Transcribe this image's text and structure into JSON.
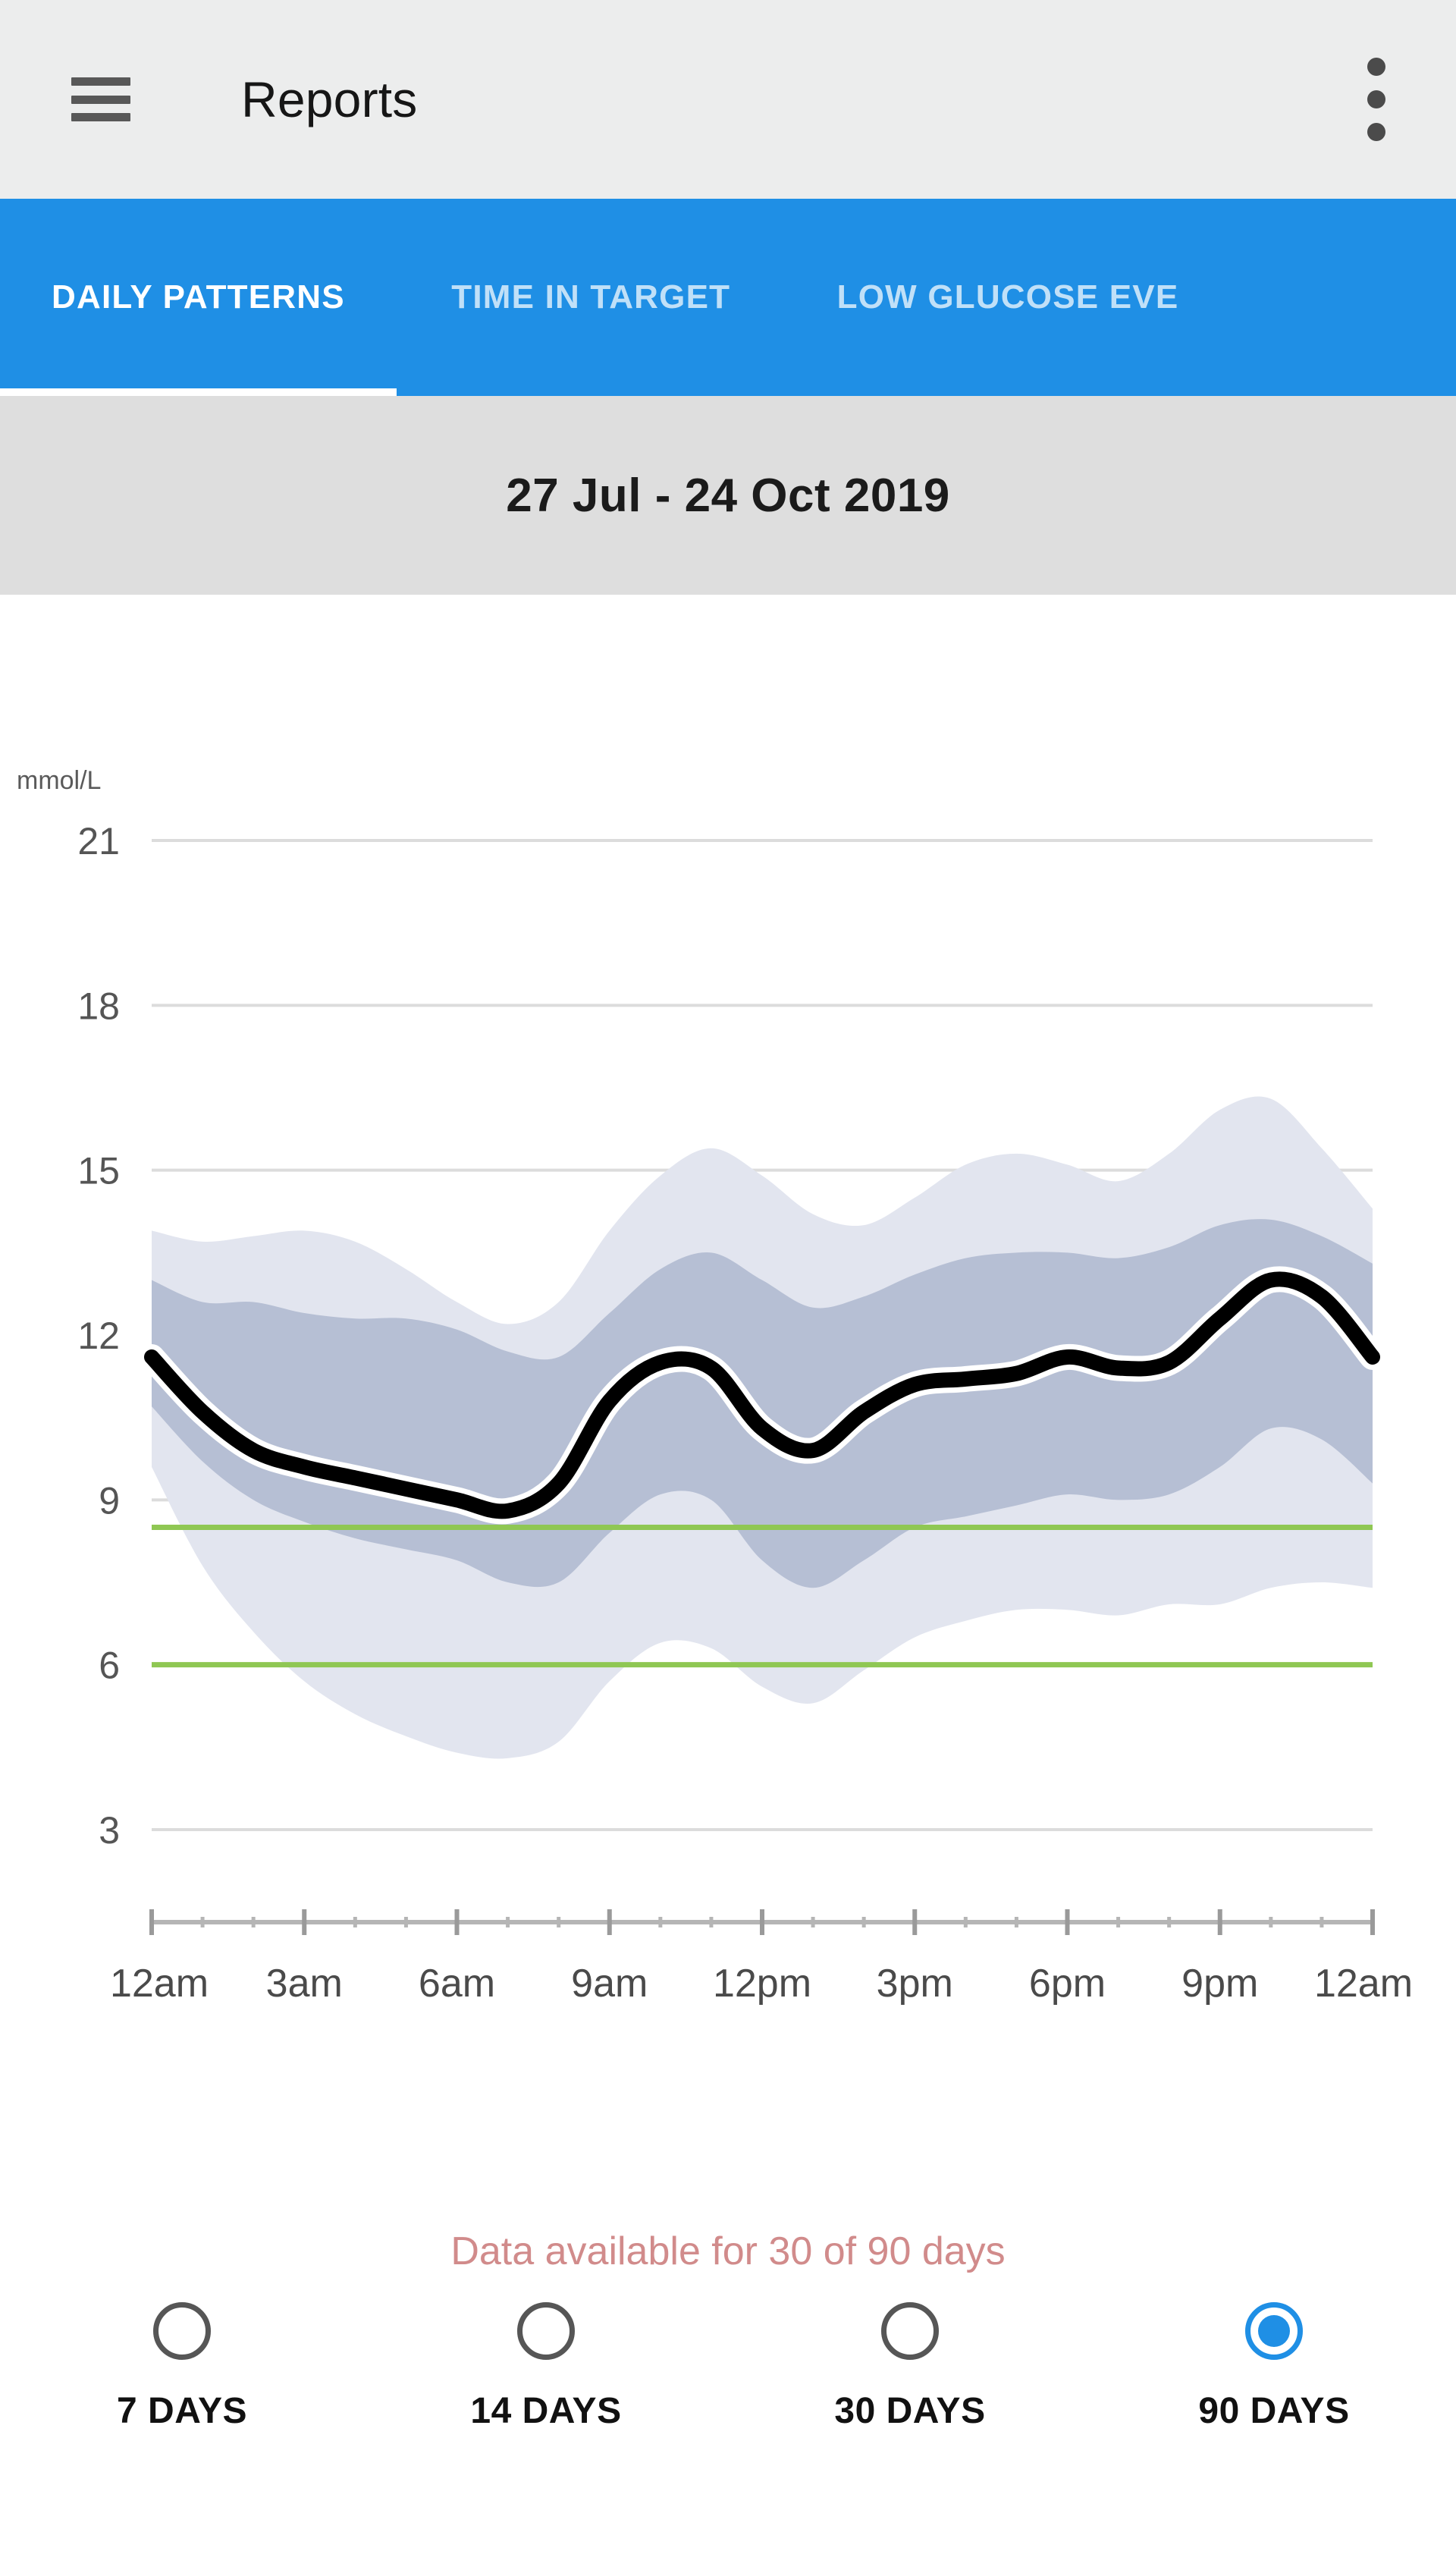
{
  "appbar": {
    "menu_icon": "hamburger-menu-icon",
    "title": "Reports",
    "overflow_icon": "more-vertical-icon"
  },
  "tabs": [
    {
      "label": "DAILY PATTERNS",
      "active": true
    },
    {
      "label": "TIME IN TARGET",
      "active": false
    },
    {
      "label": "LOW GLUCOSE EVE",
      "active": false
    }
  ],
  "date_range": "27 Jul - 24 Oct 2019",
  "footer": {
    "data_note": "Data available for 30 of 90 days"
  },
  "range_selector": {
    "options": [
      {
        "label": "7 DAYS",
        "selected": false
      },
      {
        "label": "14 DAYS",
        "selected": false
      },
      {
        "label": "30 DAYS",
        "selected": false
      },
      {
        "label": "90 DAYS",
        "selected": true
      }
    ]
  },
  "colors": {
    "accent_blue": "#1f8fe5",
    "appbar_bg": "#eceded",
    "daterange_bg": "#dedede",
    "target_line_green": "#8fc753",
    "band_outer": "#e2e5ef",
    "band_inner": "#b6bfd4",
    "median_line": "#000000",
    "note_red": "#d18b8b",
    "gridline": "#dcdcdc"
  },
  "chart_data": {
    "type": "area",
    "title": "",
    "subtitle": "",
    "xlabel": "",
    "ylabel": "mmol/L",
    "yunit": "mmol/L",
    "xlim": [
      0,
      24
    ],
    "ylim": [
      2.2,
      22.0
    ],
    "yticks": [
      21,
      18,
      15,
      12,
      9,
      6,
      3
    ],
    "ytick_labels": [
      "21",
      "18",
      "15",
      "12",
      "9",
      "6",
      "3"
    ],
    "xticks": [
      0,
      3,
      6,
      9,
      12,
      15,
      18,
      21,
      24
    ],
    "xtick_labels": [
      "12am",
      "3am",
      "6am",
      "9am",
      "12pm",
      "3pm",
      "6pm",
      "9pm",
      "12am"
    ],
    "x_minor_tick_interval_hours": 1,
    "grid": true,
    "legend": "none",
    "target_range": {
      "low": 6.0,
      "high": 8.5,
      "line_color": "#8fc753"
    },
    "x_hours": [
      0,
      1,
      2,
      3,
      4,
      5,
      6,
      7,
      8,
      9,
      10,
      11,
      12,
      13,
      14,
      15,
      16,
      17,
      18,
      19,
      20,
      21,
      22,
      23,
      24
    ],
    "series": [
      {
        "name": "median",
        "role": "line",
        "values": [
          11.6,
          10.6,
          9.9,
          9.6,
          9.4,
          9.2,
          9.0,
          8.8,
          9.3,
          10.8,
          11.5,
          11.4,
          10.3,
          9.9,
          10.6,
          11.1,
          11.2,
          11.3,
          11.6,
          11.4,
          11.5,
          12.3,
          13.0,
          12.7,
          11.6
        ]
      },
      {
        "name": "p25",
        "role": "band_inner_lower",
        "values": [
          10.7,
          9.7,
          9.0,
          8.6,
          8.3,
          8.1,
          7.9,
          7.5,
          7.5,
          8.4,
          9.1,
          9.0,
          7.9,
          7.4,
          7.9,
          8.5,
          8.7,
          8.9,
          9.1,
          9.0,
          9.1,
          9.6,
          10.3,
          10.1,
          9.3
        ]
      },
      {
        "name": "p75",
        "role": "band_inner_upper",
        "values": [
          13.0,
          12.6,
          12.6,
          12.4,
          12.3,
          12.3,
          12.1,
          11.7,
          11.6,
          12.4,
          13.2,
          13.5,
          13.0,
          12.5,
          12.7,
          13.1,
          13.4,
          13.5,
          13.5,
          13.4,
          13.6,
          14.0,
          14.1,
          13.8,
          13.3
        ]
      },
      {
        "name": "p10",
        "role": "band_outer_lower",
        "values": [
          9.6,
          7.8,
          6.6,
          5.7,
          5.1,
          4.7,
          4.4,
          4.3,
          4.6,
          5.7,
          6.4,
          6.3,
          5.6,
          5.3,
          5.9,
          6.5,
          6.8,
          7.0,
          7.0,
          6.9,
          7.1,
          7.1,
          7.4,
          7.5,
          7.4
        ]
      },
      {
        "name": "p90",
        "role": "band_outer_upper",
        "values": [
          13.9,
          13.7,
          13.8,
          13.9,
          13.7,
          13.2,
          12.6,
          12.2,
          12.6,
          13.9,
          14.9,
          15.4,
          14.9,
          14.2,
          14.0,
          14.5,
          15.1,
          15.3,
          15.1,
          14.8,
          15.3,
          16.1,
          16.3,
          15.4,
          14.3
        ]
      }
    ]
  }
}
